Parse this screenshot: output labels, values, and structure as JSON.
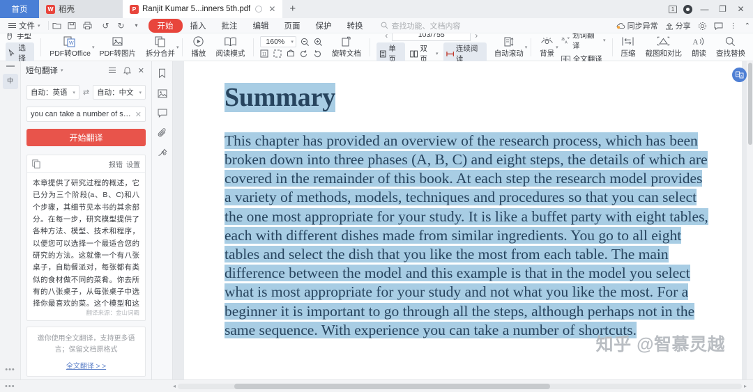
{
  "window": {
    "tabs": [
      {
        "label": "首页",
        "type": "home"
      },
      {
        "label": "稻壳",
        "type": "inactive",
        "icon": "W"
      },
      {
        "label": "Ranjit Kumar 5...inners 5th.pdf",
        "type": "active",
        "icon": "P"
      }
    ],
    "new_tab": "+",
    "controls": {
      "count": "1",
      "minimize": "—",
      "maximize": "❐",
      "close": "✕"
    }
  },
  "menubar": {
    "file": "文件",
    "quick_icons": [
      "open-folder-icon",
      "save-icon",
      "print-icon",
      "undo-icon",
      "redo-icon",
      "more-icon"
    ],
    "items": [
      {
        "label": "开始",
        "active": true
      },
      {
        "label": "插入",
        "active": false
      },
      {
        "label": "批注",
        "active": false
      },
      {
        "label": "编辑",
        "active": false
      },
      {
        "label": "页面",
        "active": false
      },
      {
        "label": "保护",
        "active": false
      },
      {
        "label": "转换",
        "active": false
      }
    ],
    "search_placeholder": "查找功能、文档内容",
    "right": [
      {
        "label": "同步异常",
        "icon": "cloud-warning-icon"
      },
      {
        "label": "分享",
        "icon": "share-icon"
      },
      {
        "label": "",
        "icon": "gear-icon"
      },
      {
        "label": "",
        "icon": "feedback-icon"
      },
      {
        "label": "",
        "icon": "more-vertical-icon"
      },
      {
        "label": "",
        "icon": "chevron-up-icon"
      }
    ]
  },
  "ribbon": {
    "hand_tool": "手型",
    "select_tool": "选择",
    "pdf_to_office": "PDF转Office",
    "pdf_to_image": "PDF转图片",
    "split_merge": "拆分合并",
    "play": "播放",
    "read_mode": "阅读模式",
    "zoom_value": "160%",
    "zoom_out": "zoom-out-icon",
    "zoom_in": "zoom-in-icon",
    "rotate_doc": "旋转文档",
    "page_value": "103/755",
    "prev_page": "‹",
    "next_page": "›",
    "single_page": "单页",
    "double_page": "双页",
    "continuous_read": "连续阅读",
    "auto_scroll": "自动滚动",
    "background": "背景",
    "word_translate": "划词翻译",
    "full_translate": "全文翻译",
    "compress": "压缩",
    "screenshot_compare": "截图和对比",
    "read_aloud": "朗读",
    "find_replace": "查找替换"
  },
  "panel": {
    "title": "短句翻译",
    "header_icons": [
      "list-icon",
      "bell-icon",
      "close-icon"
    ],
    "source_lang": "自动：英语",
    "target_lang": "自动：中文",
    "swap_icon": "swap-icon",
    "input_text": "you can take a number of shortcuts.",
    "clear_icon": "clear-icon",
    "translate_button": "开始翻译",
    "result": {
      "copy_icon": "copy-icon",
      "report": "报错",
      "settings": "设置",
      "text": "本章提供了研究过程的概述，它已分为三个阶段(a、B、C)和八个步骤，其细节见本书的其余部分。在每一步，研究模型提供了各种方法、模型、技术和程序，以便您可以选择一个最适合您的研究的方法。这就像一个有八张桌子，自助餐派对，每张都有类似的食材做不同的菜肴。你去所有的八张桌子，从每张桌子中选择你最喜欢的菜。这个模型和这个示例之间的主要区别在于，在模型中，你选择的是最适合你的学习，而不是你最喜欢的。对于一个初学者来说，完成所有的步骤是很重要的，尽管可能不是在相同的顺序中。有了经验，你可以采取许多快捷方式。",
      "source_label": "翻译来源：金山词霸"
    },
    "promo": {
      "text": "邀你使用全文翻译，支持更多语言；保留文档原格式",
      "link": "全文翻译 > >"
    },
    "rail_button": "中"
  },
  "annotation_rail": {
    "icons": [
      "bookmark-icon",
      "image-icon",
      "comment-icon",
      "attachment-icon",
      "signature-icon"
    ]
  },
  "document": {
    "heading": "Summary",
    "paragraph": "This chapter has provided an overview of the research process, which has been broken down into three phases (A, B, C) and eight steps, the details of which are covered in the remainder of this book. At each step the research model provides a variety of methods, models, techniques and procedures so that you can select the one most appropriate for your study. It is like a buffet party with eight tables, each with different dishes made from similar ingredients. You go to all eight tables and select the dish that you like the most from each table. The main difference between the model and this example is that in the model you select what is most appropriate for your study and not what you like the most. For a beginner it is important to go through all the steps, although perhaps not in the same sequence. With experience you can take a number of shortcuts.",
    "watermark": "知乎 @智慕灵越",
    "highlight_color": "#a8cde4",
    "text_color": "#27445e",
    "fab_icon": "translate-fab-icon"
  },
  "bottom": {
    "dots": "•••",
    "left_arrow": "◂",
    "right_arrow": "▸"
  }
}
